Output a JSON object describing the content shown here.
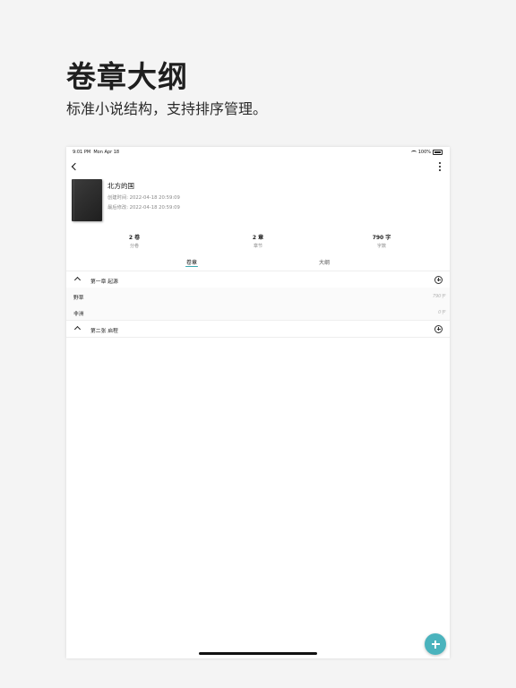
{
  "promo": {
    "title": "卷章大纲",
    "subtitle": "标准小说结构，支持排序管理。"
  },
  "status_bar": {
    "time": "9:01 PM",
    "date": "Mon Apr 18",
    "battery": "100%"
  },
  "nav": {
    "back_icon": "chevron-left-icon",
    "more_icon": "more-vertical-icon"
  },
  "book": {
    "title": "北方的国",
    "created": "创建时间: 2022-04-18 20:59:09",
    "modified": "最后修改: 2022-04-18 20:59:09"
  },
  "stats": [
    {
      "value": "2 卷",
      "label": "分卷"
    },
    {
      "value": "2 章",
      "label": "章节"
    },
    {
      "value": "790 字",
      "label": "字数"
    }
  ],
  "tabs": [
    {
      "label": "卷章",
      "active": true
    },
    {
      "label": "大纲",
      "active": false
    }
  ],
  "volumes": [
    {
      "title": "第一章 起源",
      "chapters": [
        {
          "title": "野草",
          "count": "790字"
        },
        {
          "title": "非洲",
          "count": "0字"
        }
      ]
    },
    {
      "title": "第二张 启程",
      "chapters": []
    }
  ],
  "colors": {
    "accent": "#4ab3bd",
    "tab_indicator": "#3aa8b0"
  }
}
